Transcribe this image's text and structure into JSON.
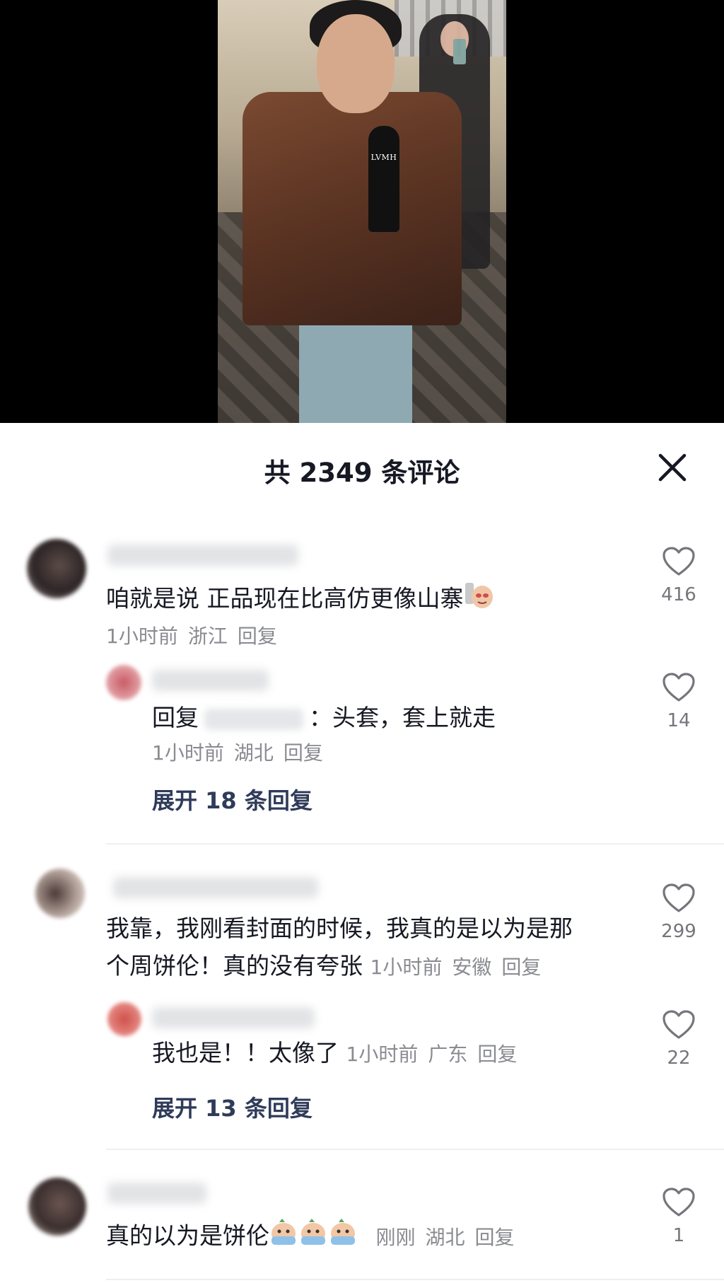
{
  "header": {
    "title": "共 2349 条评论",
    "close_icon": "close-icon"
  },
  "video": {
    "mic_label": "LVMH"
  },
  "comments": [
    {
      "text": "咱就是说 正品现在比高仿更像山寨",
      "emoji": "sly-face-emoji",
      "time": "1小时前",
      "location": "浙江",
      "reply_label": "回复",
      "likes": "416",
      "replies": [
        {
          "prefix": "回复",
          "text": "：头套，套上就走",
          "time": "1小时前",
          "location": "湖北",
          "reply_label": "回复",
          "likes": "14"
        }
      ],
      "expand_label": "展开 18 条回复"
    },
    {
      "text_line1": "我靠，我刚看封面的时候，我真的是以为是那",
      "text_line2": "个周饼伦！真的没有夸张",
      "time": "1小时前",
      "location": "安徽",
      "reply_label": "回复",
      "likes": "299",
      "replies": [
        {
          "text": "我也是！！太像了",
          "time": "1小时前",
          "location": "广东",
          "reply_label": "回复",
          "likes": "22"
        }
      ],
      "expand_label": "展开 13 条回复"
    },
    {
      "text": "真的以为是饼伦",
      "emoji": "crying-emoji",
      "time": "刚刚",
      "location": "湖北",
      "reply_label": "回复",
      "likes": "1"
    }
  ],
  "colors": {
    "accent_expand": "#2f3b59",
    "meta_gray": "#8a8b91",
    "text": "#161823"
  }
}
